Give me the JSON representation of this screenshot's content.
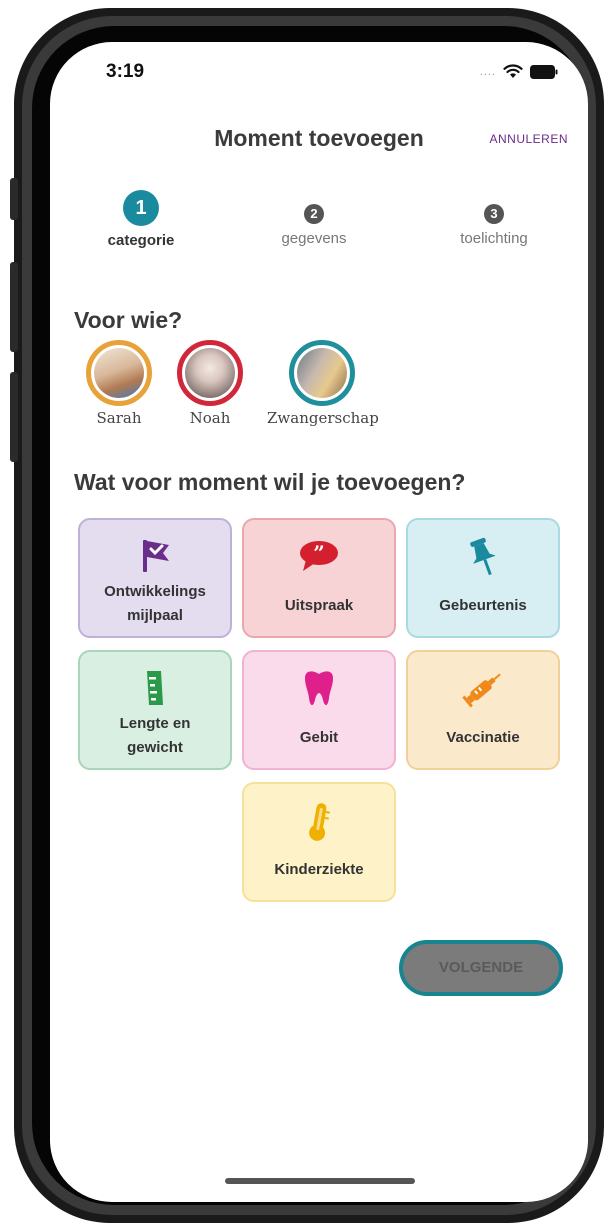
{
  "status": {
    "time": "3:19",
    "signal": "....",
    "wifi_icon": "wifi-icon",
    "battery_icon": "battery-icon"
  },
  "header": {
    "title": "Moment toevoegen",
    "cancel_label": "ANNULEREN"
  },
  "steps": [
    {
      "number": "1",
      "label": "categorie",
      "active": true
    },
    {
      "number": "2",
      "label": "gegevens",
      "active": false
    },
    {
      "number": "3",
      "label": "toelichting",
      "active": false
    }
  ],
  "who": {
    "title": "Voor wie?",
    "people": [
      {
        "name": "Sarah",
        "ring_color": "#e8a23a"
      },
      {
        "name": "Noah",
        "ring_color": "#d0283a"
      },
      {
        "name": "Zwangerschap",
        "ring_color": "#1f8f9c"
      }
    ]
  },
  "moment": {
    "title": "Wat voor moment wil je toevoegen?",
    "categories": [
      {
        "label_line1": "Ontwikkelings",
        "label_line2": "mijlpaal",
        "icon": "flag-check-icon",
        "bg": "#e4dcef",
        "border": "#bfb0d8",
        "icon_color": "#6b2d8c"
      },
      {
        "label_line1": "Uitspraak",
        "label_line2": "",
        "icon": "speech-bubble-icon",
        "bg": "#f7d3d6",
        "border": "#eaa7ae",
        "icon_color": "#d4202e"
      },
      {
        "label_line1": "Gebeurtenis",
        "label_line2": "",
        "icon": "pushpin-icon",
        "bg": "#d7eef2",
        "border": "#a9d9e1",
        "icon_color": "#1a8a9e"
      },
      {
        "label_line1": "Lengte en",
        "label_line2": "gewicht",
        "icon": "ruler-icon",
        "bg": "#d9efe1",
        "border": "#a8d6b8",
        "icon_color": "#2a9a4a"
      },
      {
        "label_line1": "Gebit",
        "label_line2": "",
        "icon": "tooth-icon",
        "bg": "#fadbeb",
        "border": "#f0b3d1",
        "icon_color": "#e0208a"
      },
      {
        "label_line1": "Vaccinatie",
        "label_line2": "",
        "icon": "syringe-icon",
        "bg": "#fbe9cc",
        "border": "#f1d09a",
        "icon_color": "#ef8a1a"
      },
      {
        "label_line1": "Kinderziekte",
        "label_line2": "",
        "icon": "thermometer-icon",
        "bg": "#fdf2c8",
        "border": "#f4e19a",
        "icon_color": "#f0b000"
      }
    ]
  },
  "footer": {
    "next_label": "VOLGENDE"
  }
}
